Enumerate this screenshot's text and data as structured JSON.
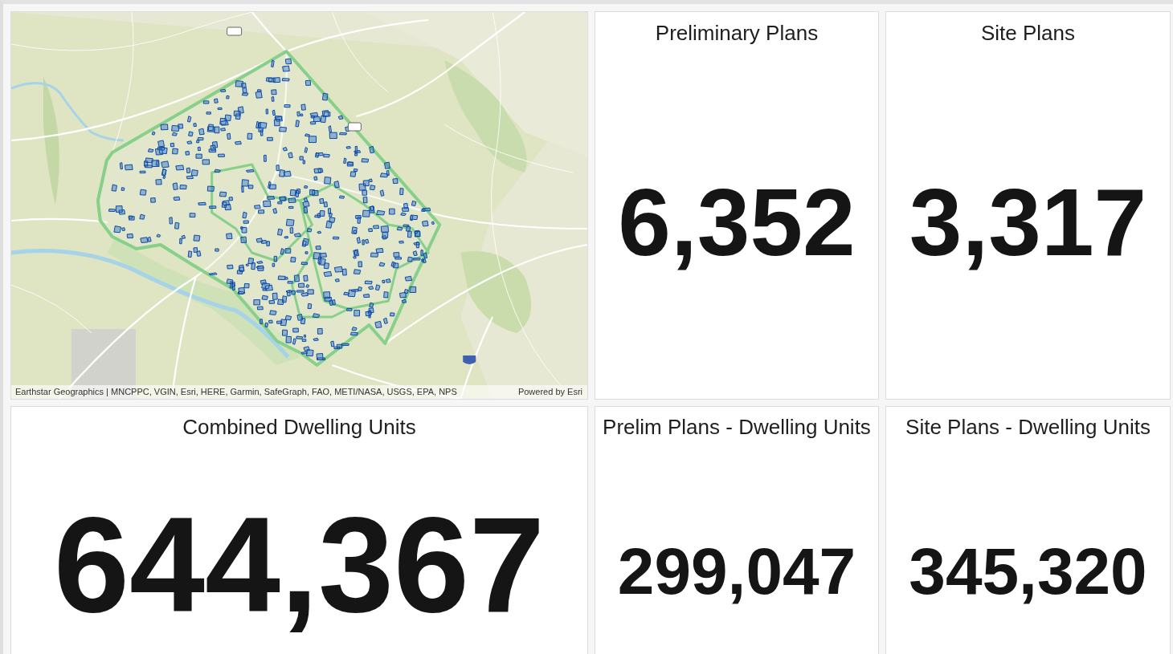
{
  "map": {
    "attribution": "Earthstar Geographics | MNCPPC, VGIN, Esri, HERE, Garmin, SafeGraph, FAO, METI/NASA, USGS, EPA, NPS",
    "powered_by": "Powered by Esri"
  },
  "indicators": [
    {
      "title": "Preliminary Plans",
      "value": "6,352"
    },
    {
      "title": "Site Plans",
      "value": "3,317"
    },
    {
      "title": "Combined Dwelling Units",
      "value": "644,367"
    },
    {
      "title": "Prelim Plans - Dwelling Units",
      "value": "299,047"
    },
    {
      "title": "Site Plans - Dwelling Units",
      "value": "345,320"
    }
  ]
}
